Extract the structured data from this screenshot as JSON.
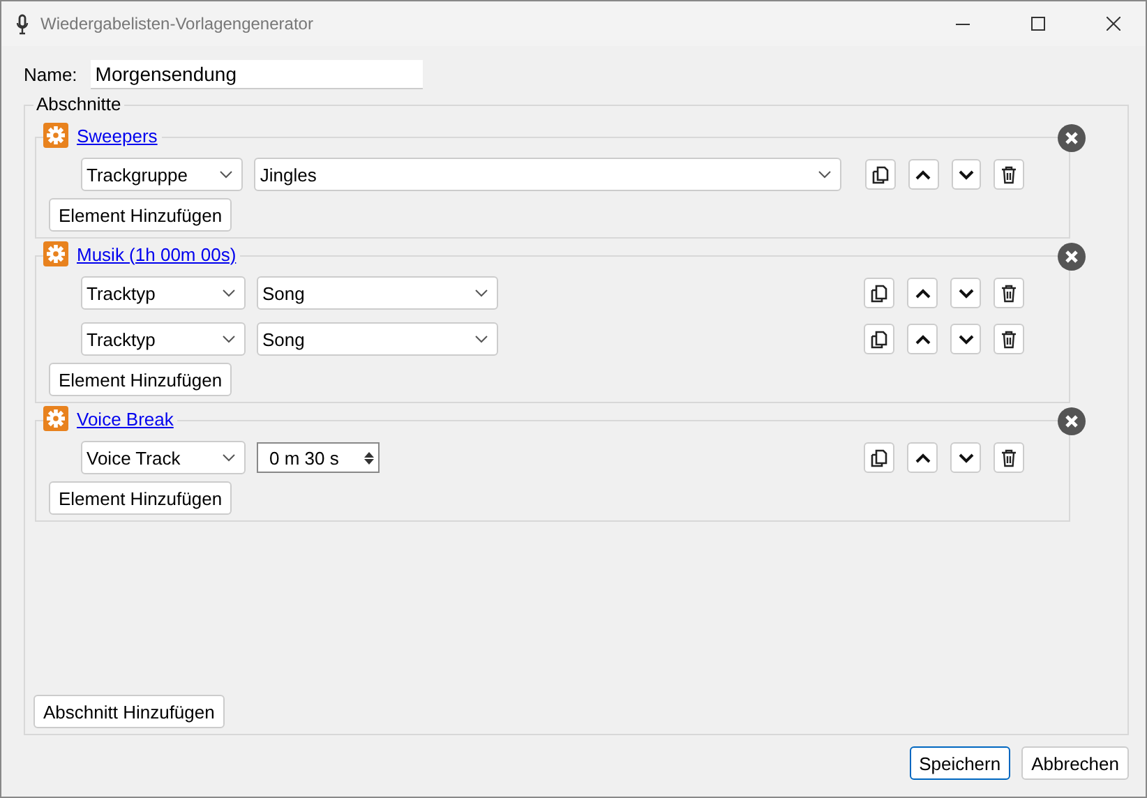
{
  "window": {
    "title": "Wiedergabelisten-Vorlagengenerator"
  },
  "name_field": {
    "label": "Name:",
    "value": "Morgensendung"
  },
  "sections_group": {
    "title": "Abschnitte",
    "sections": [
      {
        "title": "Sweepers",
        "items": [
          {
            "kind": "list",
            "type": "Trackgruppe",
            "value": "Jingles"
          }
        ],
        "add_button": "Element Hinzufügen"
      },
      {
        "title": "Musik (1h 00m 00s)",
        "items": [
          {
            "kind": "select",
            "type": "Tracktyp",
            "value": "Song"
          },
          {
            "kind": "select",
            "type": "Tracktyp",
            "value": "Song"
          }
        ],
        "add_button": "Element Hinzufügen"
      },
      {
        "title": "Voice Break",
        "items": [
          {
            "kind": "duration",
            "type": "Voice Track",
            "value": "0 m 30 s"
          }
        ],
        "add_button": "Element Hinzufügen"
      }
    ],
    "add_section_button": "Abschnitt Hinzufügen"
  },
  "buttons": [
    {
      "label": "Speichern",
      "selected": true
    },
    {
      "label": "Abbrechen",
      "selected": false
    }
  ]
}
